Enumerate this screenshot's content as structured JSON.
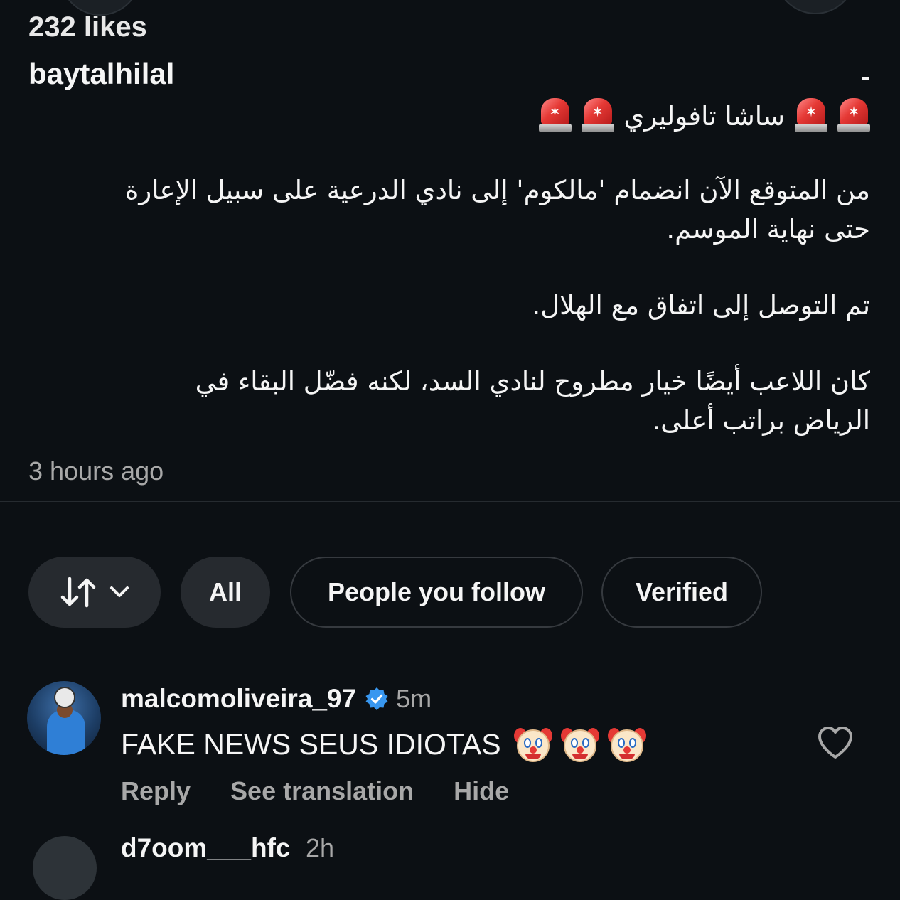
{
  "post": {
    "likes": "232 likes",
    "username": "baytalhilal",
    "caption": {
      "dash": "-",
      "headline": "ساشا تافوليري",
      "para1_line1": "من المتوقع الآن انضمام 'مالكوم' إلى نادي الدرعية على سبيل الإعارة",
      "para1_line2": "حتى نهاية الموسم.",
      "para2": "تم التوصل إلى اتفاق مع الهلال.",
      "para3_line1": "كان اللاعب أيضًا خيار مطروح لنادي السد، لكنه فضّل البقاء في",
      "para3_line2": "الرياض براتب أعلى."
    },
    "time": "3 hours ago"
  },
  "filters": {
    "sort_icon": "sort-arrows-icon",
    "chevron_icon": "chevron-down-icon",
    "chips": [
      {
        "label": "All",
        "selected": true
      },
      {
        "label": "People you follow",
        "selected": false
      },
      {
        "label": "Verified",
        "selected": false
      }
    ]
  },
  "comments": [
    {
      "username": "malcomoliveira_97",
      "verified": true,
      "time": "5m",
      "text": "FAKE NEWS SEUS IDIOTAS",
      "emoji": [
        "clown-face",
        "clown-face",
        "clown-face"
      ],
      "actions": {
        "reply": "Reply",
        "translate": "See translation",
        "hide": "Hide"
      },
      "like_icon": "heart-outline-icon"
    },
    {
      "username": "d7oom___hfc",
      "time": "2h"
    }
  ],
  "colors": {
    "background": "#0c1014",
    "text_primary": "#f5f5f5",
    "text_secondary": "#a8a8a8",
    "chip_fill": "#262a2f",
    "verified_blue": "#3897f0"
  }
}
